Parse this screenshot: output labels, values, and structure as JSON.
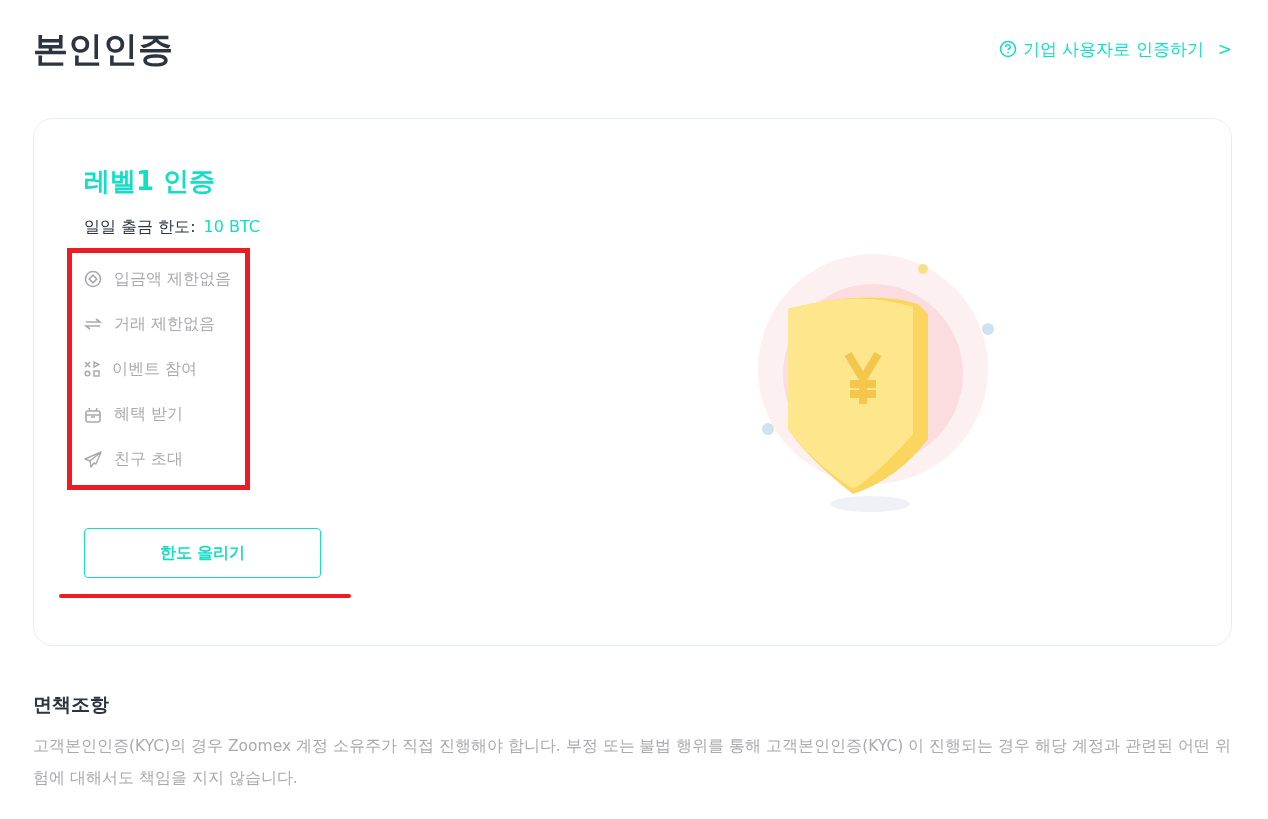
{
  "page_title": "본인인증",
  "business_link": {
    "label": "기업 사용자로 인증하기",
    "chevron": ">"
  },
  "card": {
    "title": "레벨1 인증",
    "limit_label": "일일 출금 한도:",
    "limit_value": "10 BTC",
    "features": [
      {
        "kind": "deposit",
        "label": "입금액 제한없음"
      },
      {
        "kind": "trade",
        "label": "거래 제한없음"
      },
      {
        "kind": "event",
        "label": "이벤트 참여"
      },
      {
        "kind": "gift",
        "label": "혜택 받기"
      },
      {
        "kind": "invite",
        "label": "친구 초대"
      }
    ],
    "button": "한도 올리기"
  },
  "disclaimer": {
    "title": "면책조항",
    "text": "고객본인인증(KYC)의 경우 Zoomex 계정 소유주가 직접 진행해야 합니다. 부정 또는 불법 행위를 통해 고객본인인증(KYC) 이 진행되는 경우 해당 계정과 관련된 어떤 위험에 대해서도 책임을 지지 않습니다."
  }
}
